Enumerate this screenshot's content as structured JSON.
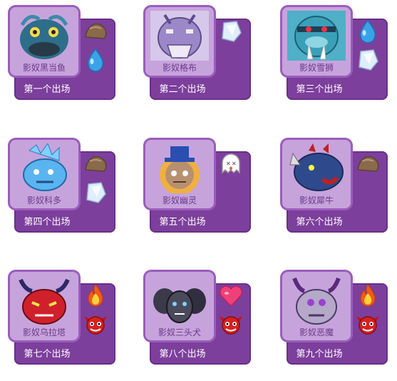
{
  "cards": [
    {
      "name": "影奴黑当鱼",
      "order": "第一个出场",
      "attr1": "rock-icon",
      "attr2": "water-drop-icon",
      "art": "fish"
    },
    {
      "name": "影奴格布",
      "order": "第二个出场",
      "attr1": "ice-crystal-icon",
      "attr2": "",
      "art": "ogre"
    },
    {
      "name": "影奴雪狮",
      "order": "第三个出场",
      "attr1": "water-drop-icon",
      "attr2": "ice-crystal-icon",
      "art": "walrus"
    },
    {
      "name": "影奴科多",
      "order": "第四个出场",
      "attr1": "rock-icon",
      "attr2": "ice-crystal-icon",
      "art": "dino"
    },
    {
      "name": "影奴幽灵",
      "order": "第五个出场",
      "attr1": "ghost-icon",
      "attr2": "",
      "art": "ghost"
    },
    {
      "name": "影奴犀牛",
      "order": "第六个出场",
      "attr1": "rock-icon",
      "attr2": "",
      "art": "rhino"
    },
    {
      "name": "影奴乌拉塔",
      "order": "第七个出场",
      "attr1": "fire-icon",
      "attr2": "demon-icon",
      "art": "dragon"
    },
    {
      "name": "影奴三头犬",
      "order": "第八个出场",
      "attr1": "heart-icon",
      "attr2": "demon-icon",
      "art": "cerberus"
    },
    {
      "name": "影奴恶魔",
      "order": "第九个出场",
      "attr1": "fire-icon",
      "attr2": "demon-icon",
      "art": "demon"
    }
  ],
  "colors": {
    "panel": "#7d3f9c",
    "portrait_bg": "#c7a3dc",
    "border": "#9b5cbd",
    "name_text": "#6a3a8a"
  }
}
